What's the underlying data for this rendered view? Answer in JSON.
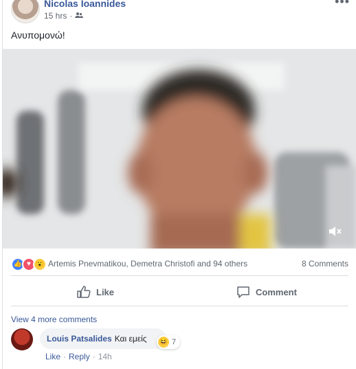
{
  "post": {
    "author": "Nicolas Ioannides",
    "time": "15 hrs",
    "separator": "·",
    "text": "Ανυπομονώ!"
  },
  "icons": {
    "audience": "friends-icon",
    "more": "more-options-icon",
    "mute": "muted-speaker-icon"
  },
  "reactions": {
    "summary": "Artemis Pnevmatikou, Demetra Christofi and 94 others",
    "comments_count": "8 Comments"
  },
  "actions": {
    "like": "Like",
    "comment": "Comment"
  },
  "comments": {
    "view_more": "View 4 more comments",
    "items": [
      {
        "name": "Louis Patsalides",
        "text": "Και εμείς",
        "reaction_count": "7",
        "like": "Like",
        "reply": "Reply",
        "sep": "·",
        "time": "14h"
      }
    ]
  },
  "colors": {
    "link": "#385898",
    "like_blue": "#4080ff",
    "love_red": "#f25268",
    "wow_yellow": "#fbcd41"
  }
}
